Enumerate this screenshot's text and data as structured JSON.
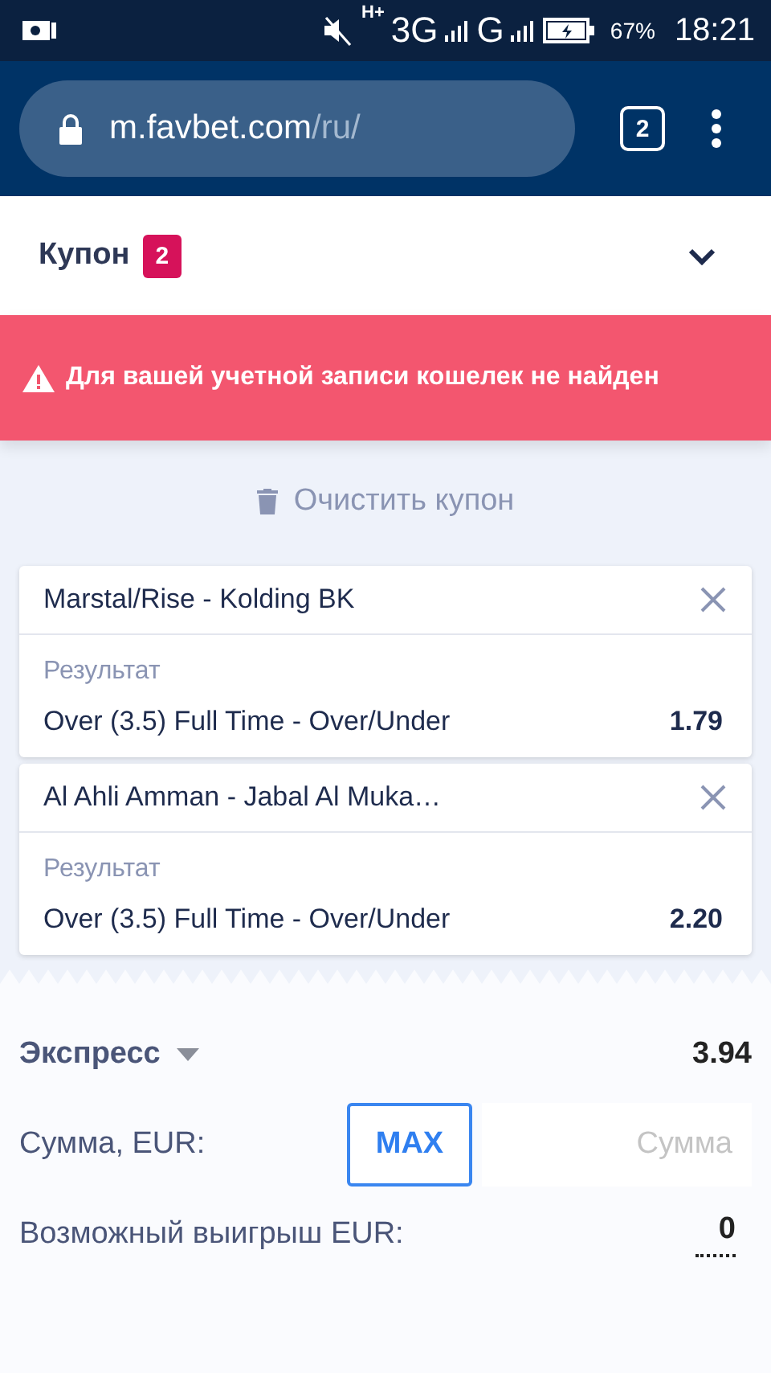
{
  "status_bar": {
    "network_type": "H+",
    "network_1": "3G",
    "network_2": "G",
    "battery": "67%",
    "time": "18:21"
  },
  "browser": {
    "url_host": "m.favbet.com",
    "url_path": "/ru/",
    "tab_count": "2"
  },
  "coupon": {
    "title": "Купон",
    "count": "2"
  },
  "alert": {
    "text": "Для вашей учетной записи кошелек не найден"
  },
  "clear_button": "Очистить купон",
  "bets": [
    {
      "event": "Marstal/Rise - Kolding BK",
      "market": "Результат",
      "selection": "Over (3.5) Full Time - Over/Under",
      "odds": "1.79"
    },
    {
      "event": "Al Ahli Amman - Jabal Al Muka…",
      "market": "Результат",
      "selection": "Over (3.5) Full Time - Over/Under",
      "odds": "2.20"
    }
  ],
  "summary": {
    "bet_type": "Экспресс",
    "total_odds": "3.94",
    "stake_label": "Сумма, EUR:",
    "max_button": "MAX",
    "stake_placeholder": "Сумма",
    "win_label": "Возможный выигрыш EUR:",
    "win_value": "0"
  }
}
